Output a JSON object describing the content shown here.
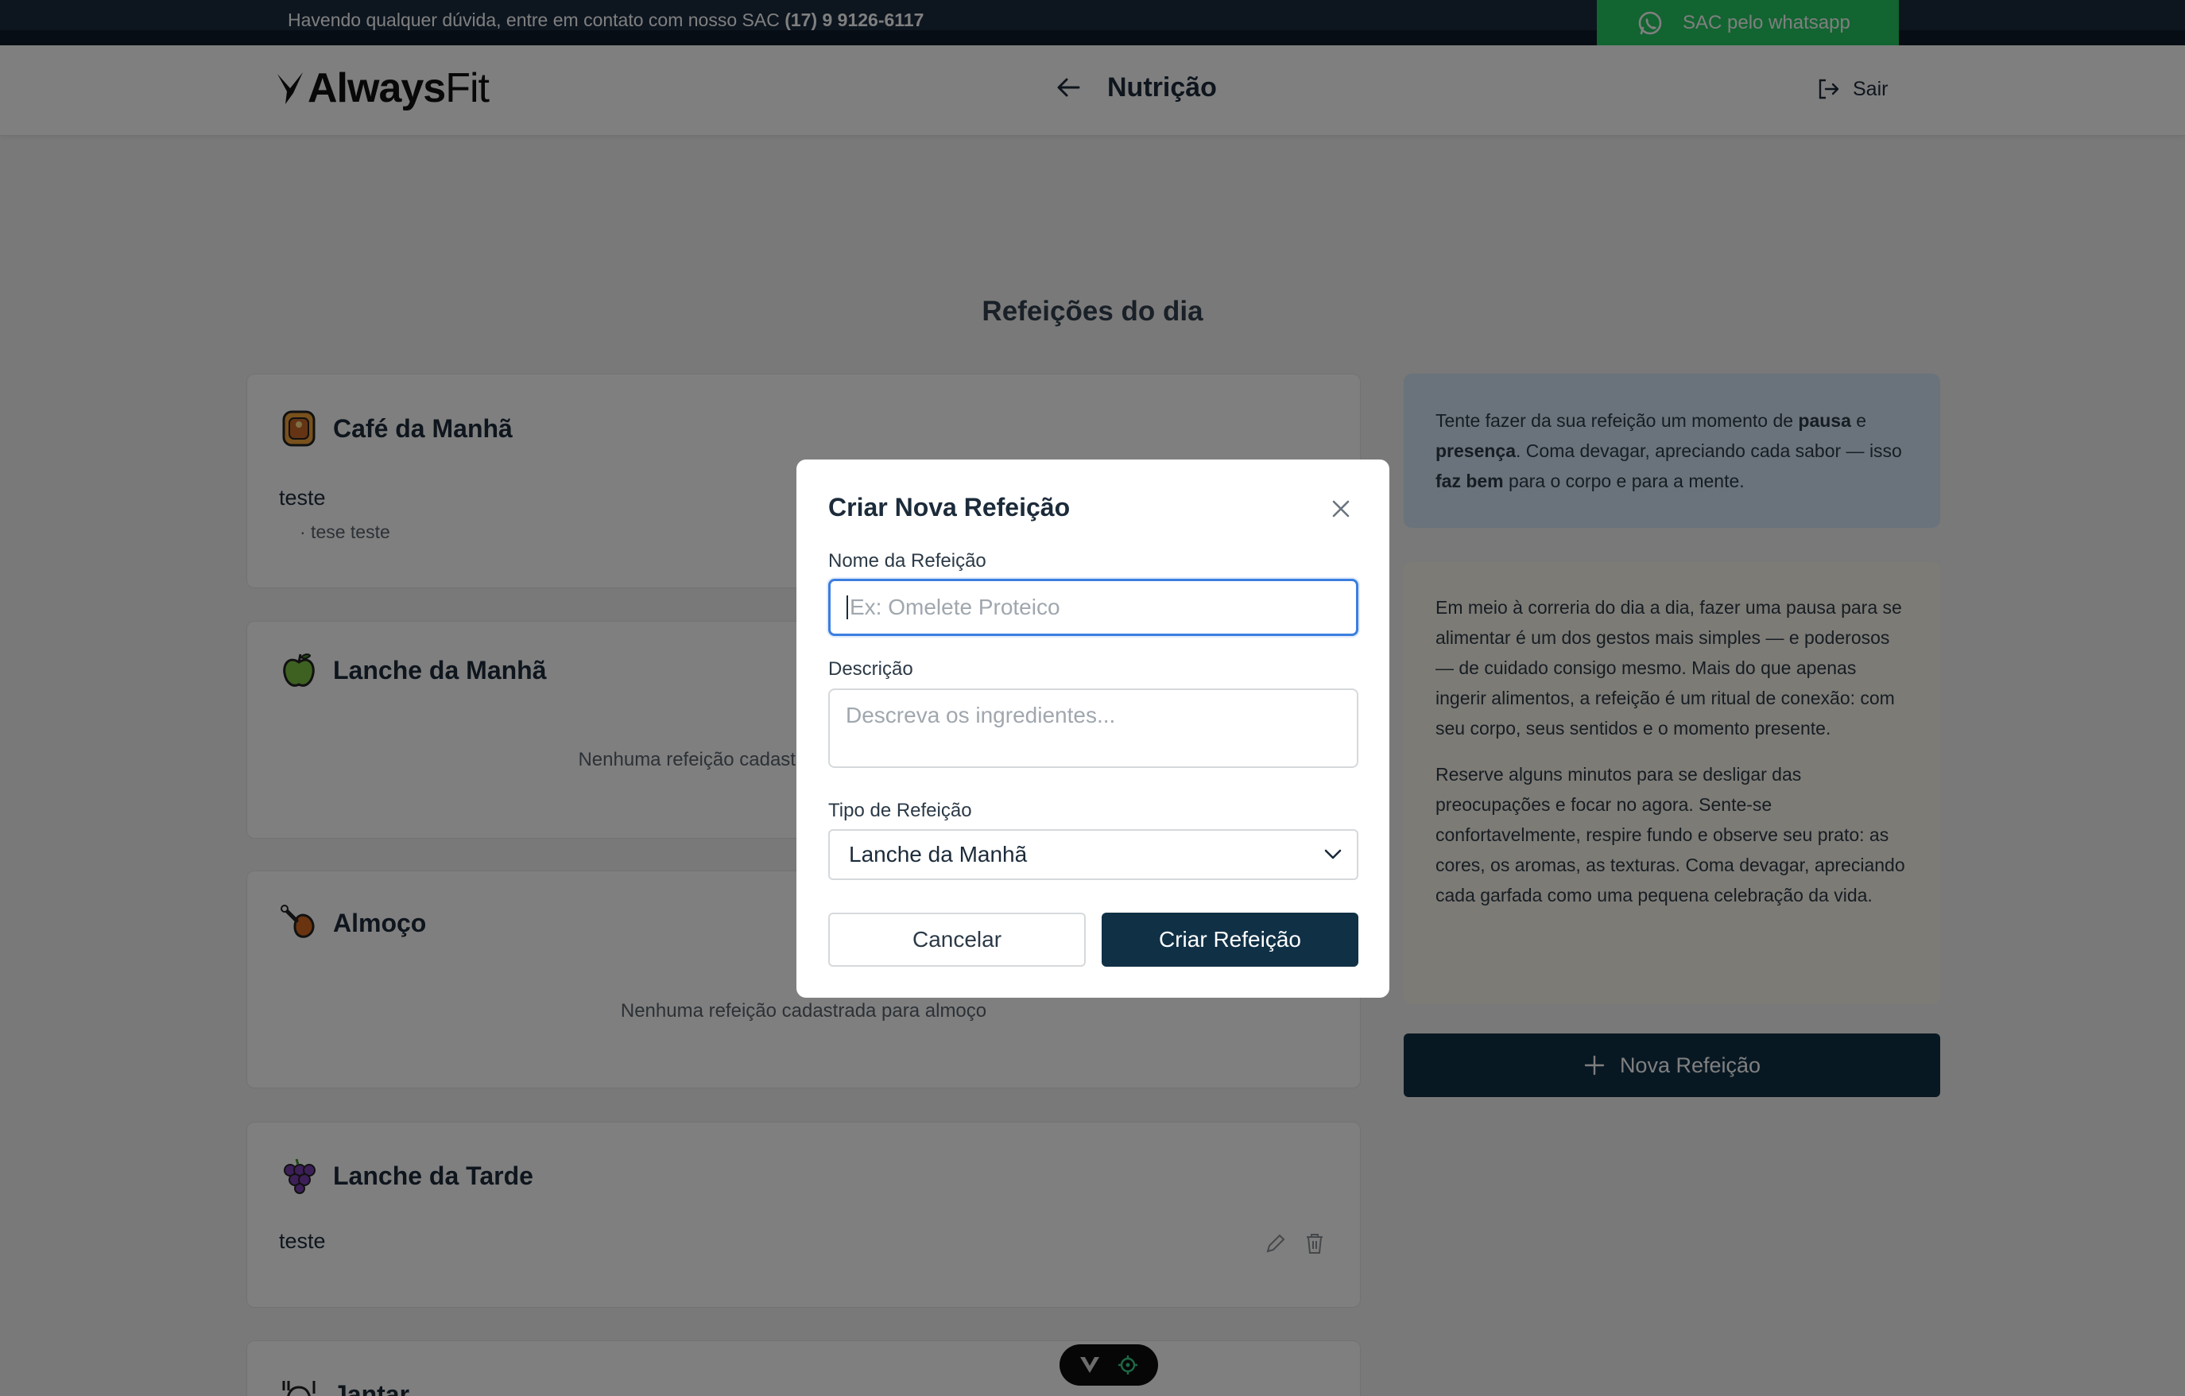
{
  "topbar": {
    "message": "Havendo qualquer dúvida, entre em contato com nosso SAC",
    "phone": "(17) 9 9126-6117",
    "whatsapp_label": "SAC pelo whatsapp"
  },
  "header": {
    "logo_bold": "Always",
    "logo_light": "Fit",
    "title": "Nutrição",
    "logout_label": "Sair"
  },
  "main": {
    "page_title": "Refeições do dia",
    "cards": [
      {
        "label": "Café da Manhã",
        "icon": "pancake-icon",
        "meal_name": "teste",
        "meal_desc": "· tese teste"
      },
      {
        "label": "Lanche da Manhã",
        "icon": "apple-icon",
        "empty": "Nenhuma refeição cadastrada para lanche da manhã"
      },
      {
        "label": "Almoço",
        "icon": "chicken-leg-icon",
        "empty": "Nenhuma refeição cadastrada para almoço"
      },
      {
        "label": "Lanche da Tarde",
        "icon": "grapes-icon",
        "meal_name": "teste"
      },
      {
        "label": "Jantar",
        "icon": "dinner-icon"
      }
    ]
  },
  "sidebar": {
    "tip_parts": [
      "Tente fazer da sua refeição um momento de ",
      "pausa",
      " e ",
      "presença",
      ". Coma devagar, apreciando cada sabor — isso ",
      "faz bem",
      " para o corpo e para a mente."
    ],
    "paragraph_1": "Em meio à correria do dia a dia, fazer uma pausa para se alimentar é um dos gestos mais simples — e poderosos — de cuidado consigo mesmo. Mais do que apenas ingerir alimentos, a refeição é um ritual de conexão: com seu corpo, seus sentidos e o momento presente.",
    "paragraph_2": "Reserve alguns minutos para se desligar das preocupações e focar no agora. Sente-se confortavelmente, respire fundo e observe seu prato: as cores, os aromas, as texturas. Coma devagar, apreciando cada garfada como uma pequena celebração da vida.",
    "new_meal_label": "Nova Refeição"
  },
  "modal": {
    "title": "Criar Nova Refeição",
    "name_label": "Nome da Refeição",
    "name_placeholder": "Ex: Omelete Proteico",
    "description_label": "Descrição",
    "description_placeholder": "Descreva os ingredientes...",
    "type_label": "Tipo de Refeição",
    "type_value": "Lanche da Manhã",
    "cancel_label": "Cancelar",
    "create_label": "Criar Refeição"
  },
  "colors": {
    "dark_navy": "#103046",
    "topbar": "#1a2b3f",
    "whatsapp_green": "#24c962",
    "focus_blue": "#3b7ee0",
    "tip_blue_bg": "#d5e7f7",
    "tip_beige_bg": "#faf6ec"
  }
}
